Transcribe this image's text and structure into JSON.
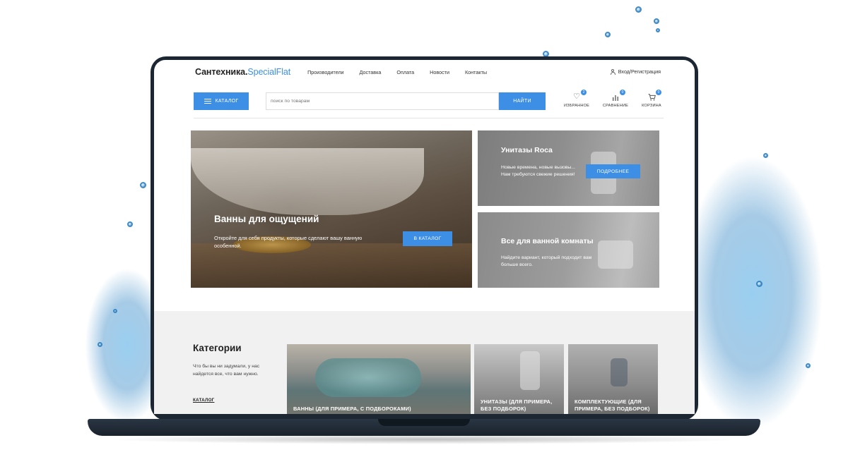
{
  "site": {
    "logo_main": "Сантехника.",
    "logo_accent": "SpecialFlat",
    "nav": [
      "Производители",
      "Доставка",
      "Оплата",
      "Новости",
      "Контакты"
    ],
    "login": "Вход/Регистрация"
  },
  "search": {
    "catalog_label": "КАТАЛОГ",
    "placeholder": "поиск по товарам",
    "button": "НАЙТИ"
  },
  "icons": [
    {
      "label": "ИЗБРАННОЕ",
      "count": "2",
      "icon": "heart-icon"
    },
    {
      "label": "СРАВНЕНИЕ",
      "count": "0",
      "icon": "compare-icon"
    },
    {
      "label": "КОРЗИНА",
      "count": "0",
      "icon": "cart-icon"
    }
  ],
  "banners": {
    "main": {
      "title": "Ванны для ощущений",
      "text": "Откройте для себя продукты, которые сделают вашу ванную особенной.",
      "button": "В КАТАЛОГ"
    },
    "top": {
      "title": "Унитазы Roca",
      "text": "Новые времена, новые вызовы... Нам требуются свежие решения!",
      "button": "ПОДРОБНЕЕ"
    },
    "bottom": {
      "title": "Все для ванной комнаты",
      "text": "Найдите вариант, который подходит вам больше всего."
    }
  },
  "categories": {
    "heading": "Категории",
    "description": "Что бы вы ни задумали, у нас найдется все, что вам нужно.",
    "link": "КАТАЛОГ",
    "cards": [
      "ВАННЫ (ДЛЯ ПРИМЕРА, С ПОДБОРОКАМИ)",
      "УНИТАЗЫ (ДЛЯ ПРИМЕРА, БЕЗ ПОДБОРОК)",
      "КОМПЛЕКТУЮЩИЕ (ДЛЯ ПРИМЕРА, БЕЗ ПОДБОРОК)"
    ]
  },
  "colors": {
    "accent": "#3d8fe6",
    "laptop": "#1c2733"
  }
}
